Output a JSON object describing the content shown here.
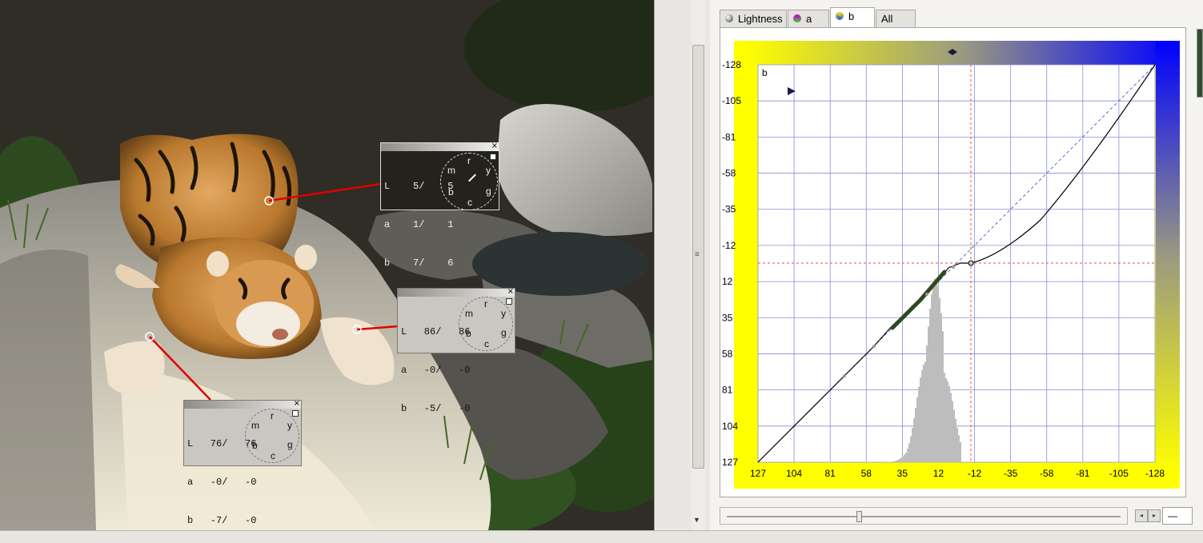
{
  "photo": {
    "readouts": [
      {
        "name": "readout-top",
        "rows": [
          "L    5/    5",
          "a    1/    1",
          "b    7/    6"
        ],
        "dark": true
      },
      {
        "name": "readout-right",
        "rows": [
          "L   86/   86",
          "a   -0/   -0",
          "b   -5/   -0"
        ],
        "dark": false
      },
      {
        "name": "readout-bottom",
        "rows": [
          "L   76/   76",
          "a   -0/   -0",
          "b   -7/   -0"
        ],
        "dark": false
      }
    ],
    "dial_letters": {
      "r": "r",
      "y": "y",
      "g": "g",
      "c": "c",
      "b": "b",
      "m": "m"
    },
    "close_glyph": "×"
  },
  "tabs": [
    {
      "label": "Lightness",
      "active": false
    },
    {
      "label": "a",
      "active": false
    },
    {
      "label": "b",
      "active": true
    },
    {
      "label": "All",
      "active": false
    }
  ],
  "curve": {
    "channel_label": "b",
    "y_ticks": [
      "-128",
      "-105",
      "-81",
      "-58",
      "-35",
      "-12",
      "12",
      "35",
      "58",
      "81",
      "104",
      "127"
    ],
    "x_ticks": [
      "127",
      "104",
      "81",
      "58",
      "35",
      "12",
      "-12",
      "-35",
      "-58",
      "-81",
      "-105",
      "-128"
    ],
    "colors": {
      "yellow": "#ffff00",
      "blue": "#0000ff",
      "grid": "#8a8ad8",
      "curve": "#000000",
      "histogram": "#bdbdbd"
    }
  },
  "slider": {
    "value": "—",
    "prev": "◂",
    "next": "▸"
  },
  "scroll": {
    "grip": "≡",
    "down": "▼"
  }
}
